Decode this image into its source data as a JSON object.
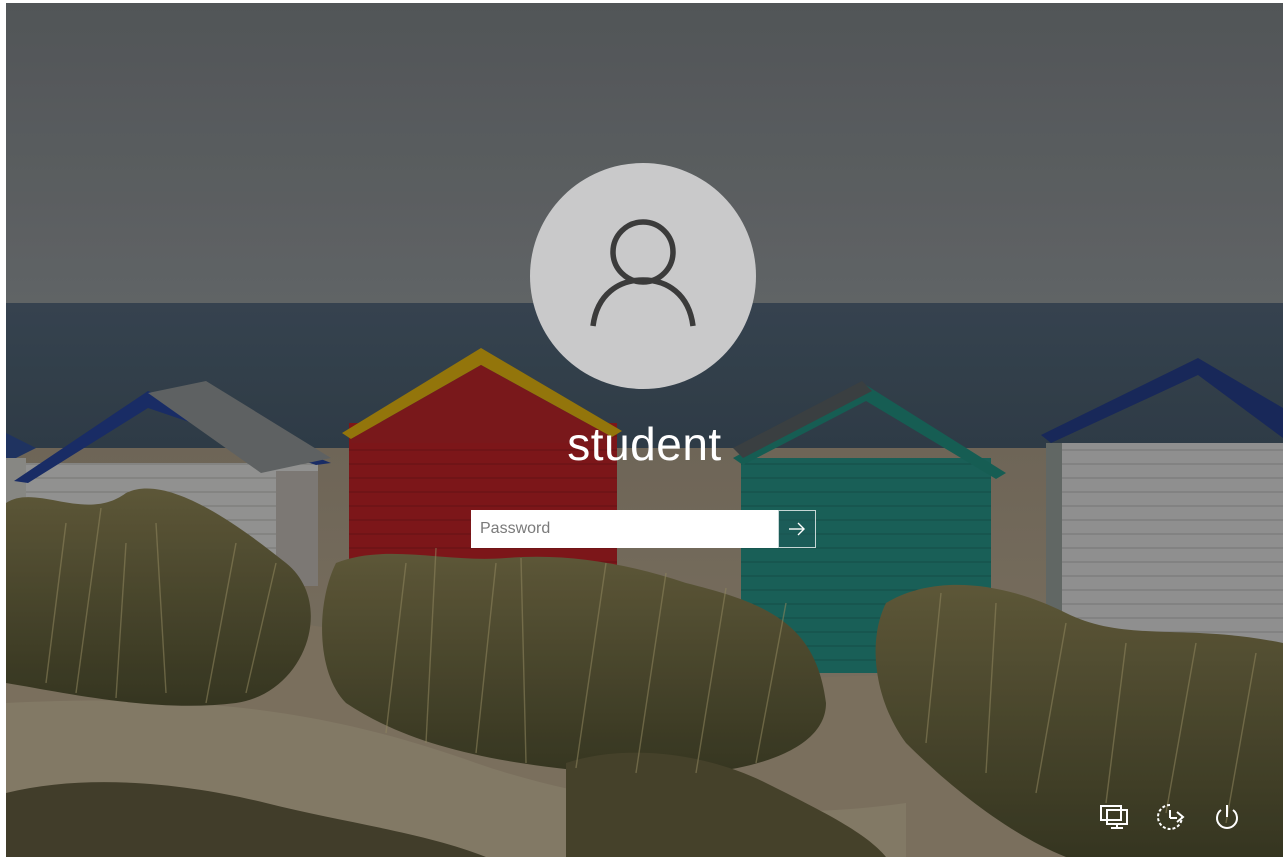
{
  "user": {
    "name": "student"
  },
  "password": {
    "placeholder": "Password",
    "value": ""
  },
  "submit": {
    "icon": "arrow-right-icon"
  },
  "corner_buttons": [
    {
      "name": "network",
      "icon": "network-icon"
    },
    {
      "name": "ease-of-access",
      "icon": "ease-of-access-icon"
    },
    {
      "name": "power",
      "icon": "power-icon"
    }
  ],
  "colors": {
    "avatar_bg": "#c9c9ca",
    "avatar_glyph": "#3b3b3b",
    "text": "#ffffff",
    "submit_bg": "#1e5a5a"
  }
}
